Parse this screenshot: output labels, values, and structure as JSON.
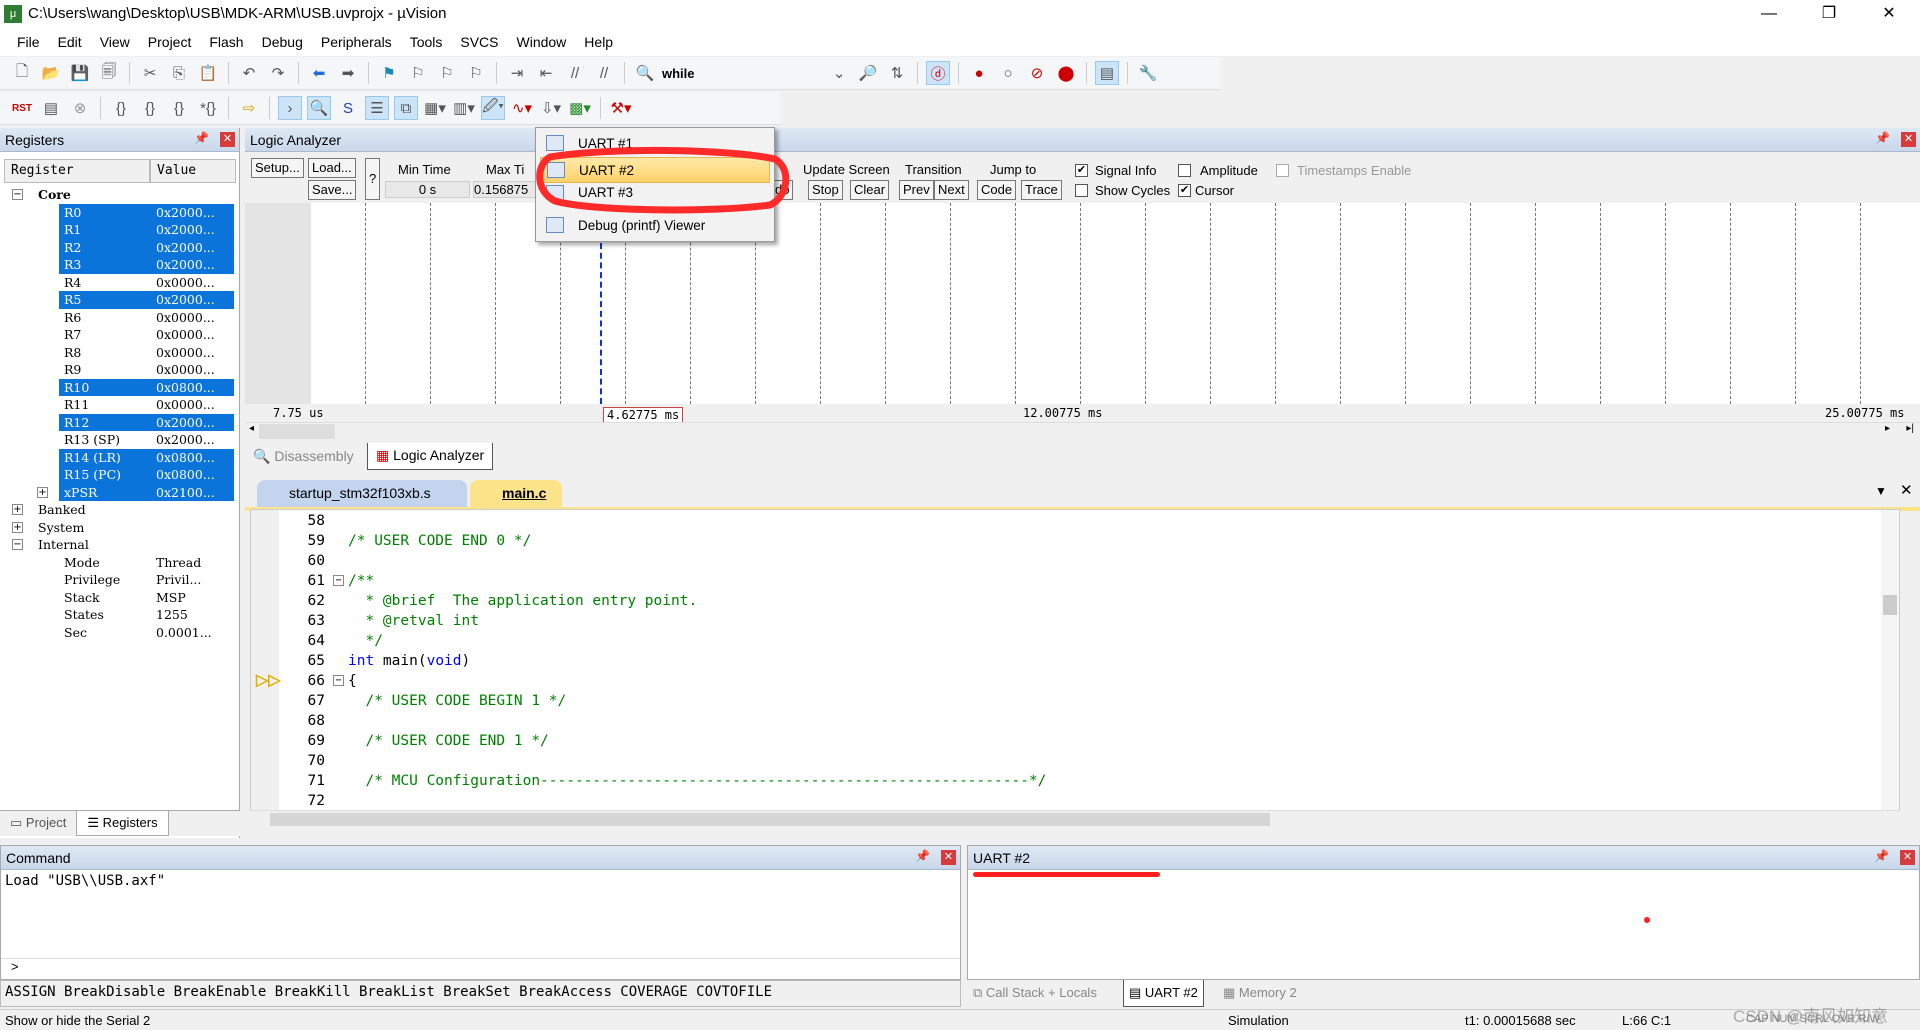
{
  "window": {
    "title": "C:\\Users\\wang\\Desktop\\USB\\MDK-ARM\\USB.uvprojx - µVision",
    "minimize": "—",
    "maximize": "❐",
    "close": "✕"
  },
  "menu": [
    "File",
    "Edit",
    "View",
    "Project",
    "Flash",
    "Debug",
    "Peripherals",
    "Tools",
    "SVCS",
    "Window",
    "Help"
  ],
  "toolbar": {
    "find_text": "while"
  },
  "registers": {
    "title": "Registers",
    "col_register": "Register",
    "col_value": "Value",
    "core_label": "Core",
    "core": [
      {
        "name": "R0",
        "value": "0x2000...",
        "selected": true
      },
      {
        "name": "R1",
        "value": "0x2000...",
        "selected": true
      },
      {
        "name": "R2",
        "value": "0x2000...",
        "selected": true
      },
      {
        "name": "R3",
        "value": "0x2000...",
        "selected": true
      },
      {
        "name": "R4",
        "value": "0x0000...",
        "selected": false
      },
      {
        "name": "R5",
        "value": "0x2000...",
        "selected": true
      },
      {
        "name": "R6",
        "value": "0x0000...",
        "selected": false
      },
      {
        "name": "R7",
        "value": "0x0000...",
        "selected": false
      },
      {
        "name": "R8",
        "value": "0x0000...",
        "selected": false
      },
      {
        "name": "R9",
        "value": "0x0000...",
        "selected": false
      },
      {
        "name": "R10",
        "value": "0x0800...",
        "selected": true
      },
      {
        "name": "R11",
        "value": "0x0000...",
        "selected": false
      },
      {
        "name": "R12",
        "value": "0x2000...",
        "selected": true
      },
      {
        "name": "R13 (SP)",
        "value": "0x2000...",
        "selected": false
      },
      {
        "name": "R14 (LR)",
        "value": "0x0800...",
        "selected": true
      },
      {
        "name": "R15 (PC)",
        "value": "0x0800...",
        "selected": true
      },
      {
        "name": "xPSR",
        "value": "0x2100...",
        "selected": true
      }
    ],
    "groups": [
      "Banked",
      "System",
      "Internal"
    ],
    "internal": [
      {
        "name": "Mode",
        "value": "Thread"
      },
      {
        "name": "Privilege",
        "value": "Privil..."
      },
      {
        "name": "Stack",
        "value": "MSP"
      },
      {
        "name": "States",
        "value": "1255"
      },
      {
        "name": "Sec",
        "value": "0.0001..."
      }
    ],
    "tabs": [
      "Project",
      "Registers"
    ]
  },
  "logic_analyzer": {
    "title": "Logic Analyzer",
    "setup": "Setup...",
    "load": "Load...",
    "save": "Save...",
    "help": "?",
    "min_time_label": "Min Time",
    "min_time": "0 s",
    "max_time_label": "Max Ti",
    "max_time": "0.156875",
    "zoom_partial": "do",
    "update_screen": "Update Screen",
    "stop": "Stop",
    "clear": "Clear",
    "transition": "Transition",
    "prev": "Prev",
    "next": "Next",
    "jump_to": "Jump to",
    "code": "Code",
    "trace": "Trace",
    "signal_info": "Signal Info",
    "signal_info_checked": true,
    "amplitude": "Amplitude",
    "amplitude_checked": false,
    "timestamps": "Timestamps Enable",
    "timestamps_checked": false,
    "show_cycles": "Show Cycles",
    "show_cycles_checked": false,
    "cursor": "Cursor",
    "cursor_checked": true,
    "time_start": "7.75 us",
    "time_cursor": "4.62775 ms",
    "time_mid": "12.00775 ms",
    "time_end": "25.00775 ms"
  },
  "dropdown": {
    "items": [
      "UART #1",
      "UART #2",
      "UART #3",
      "Debug (printf) Viewer"
    ],
    "highlighted": "UART #2"
  },
  "view_tabs": [
    "Disassembly",
    "Logic Analyzer"
  ],
  "editor": {
    "tabs": [
      "startup_stm32f103xb.s",
      "main.c"
    ],
    "active": "main.c",
    "lines": [
      {
        "n": "58",
        "t": "",
        "c": ""
      },
      {
        "n": "59",
        "t": "/* USER CODE END 0 */",
        "c": "cm"
      },
      {
        "n": "60",
        "t": "",
        "c": ""
      },
      {
        "n": "61",
        "t": "/**",
        "c": "cm"
      },
      {
        "n": "62",
        "t": "  * @brief  The application entry point.",
        "c": "cm"
      },
      {
        "n": "63",
        "t": "  * @retval int",
        "c": "cm"
      },
      {
        "n": "64",
        "t": "  */",
        "c": "cm"
      },
      {
        "n": "65",
        "t": "int main(void)",
        "c": "code"
      },
      {
        "n": "66",
        "t": "{",
        "c": ""
      },
      {
        "n": "67",
        "t": "  /* USER CODE BEGIN 1 */",
        "c": "cm"
      },
      {
        "n": "68",
        "t": "",
        "c": ""
      },
      {
        "n": "69",
        "t": "  /* USER CODE END 1 */",
        "c": "cm"
      },
      {
        "n": "70",
        "t": "",
        "c": ""
      },
      {
        "n": "71",
        "t": "  /* MCU Configuration--------------------------------------------------------*/",
        "c": "cm"
      },
      {
        "n": "72",
        "t": "",
        "c": ""
      }
    ]
  },
  "command": {
    "title": "Command",
    "output": "Load \"USB\\\\USB.axf\"",
    "prompt": ">",
    "keywords": "ASSIGN BreakDisable BreakEnable BreakKill BreakList BreakSet BreakAccess COVERAGE COVTOFILE"
  },
  "uart": {
    "title": "UART #2",
    "tabs": [
      "Call Stack + Locals",
      "UART #2",
      "Memory 2"
    ]
  },
  "status": {
    "hint": "Show or hide the Serial 2",
    "mode": "Simulation",
    "t1": "t1: 0.00015688 sec",
    "pos": "L:66 C:1",
    "flags": "CAP NUM SCRL OVR R/W",
    "watermark": "CSDN @南风如知意"
  },
  "colors": {
    "selection": "#0a74da",
    "annotation": "#ff2020",
    "comment": "#008000",
    "keyword": "#0000ff"
  }
}
